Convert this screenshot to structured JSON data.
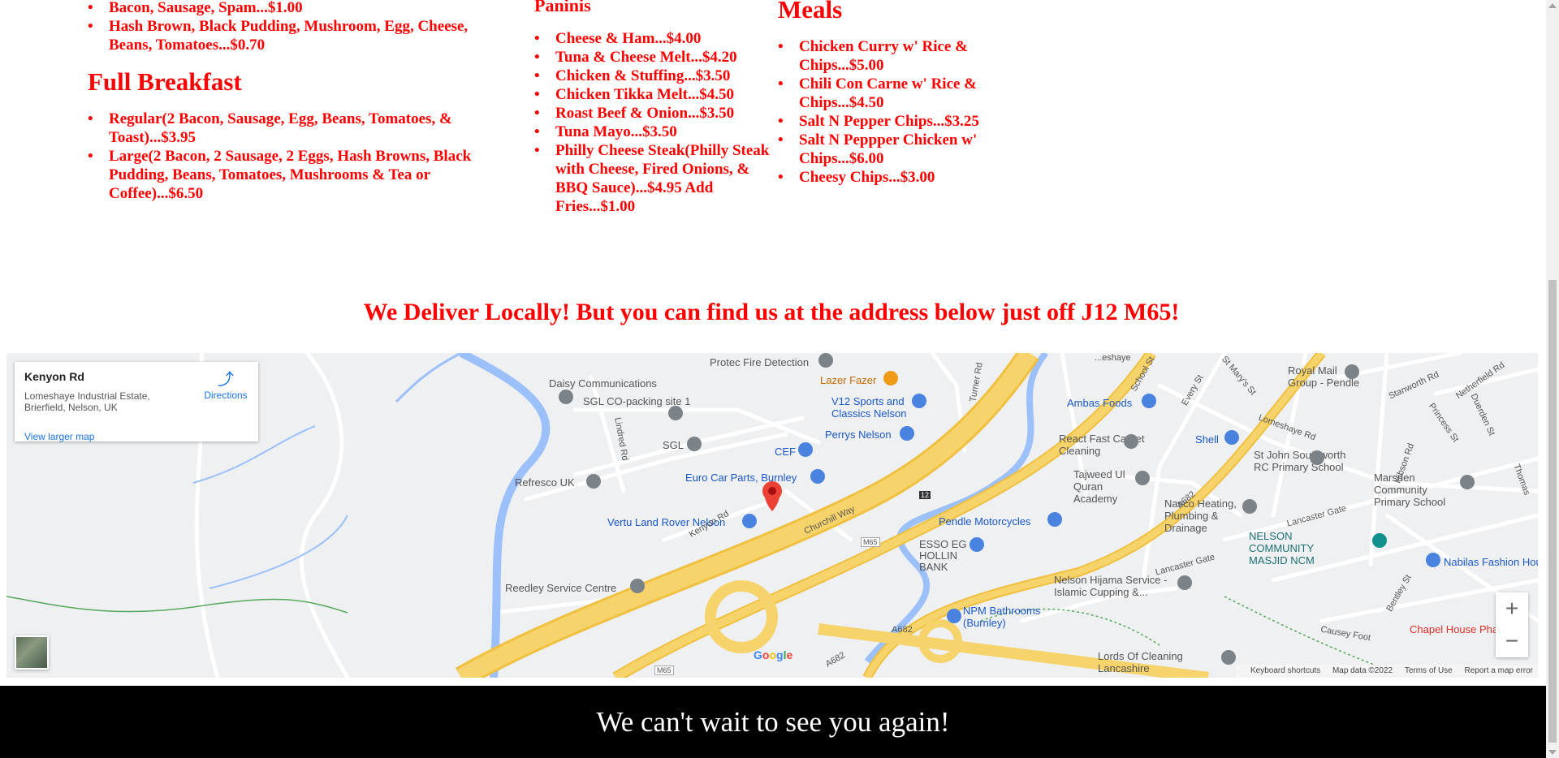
{
  "menu": {
    "col1": {
      "items_top": [
        "Bacon, Sausage, Spam...$1.00",
        "Hash Brown, Black Pudding, Mushroom, Egg, Cheese, Beans, Tomatoes...$0.70"
      ],
      "full_breakfast_heading": "Full Breakfast",
      "full_breakfast_items": [
        "Regular(2 Bacon, Sausage, Egg, Beans, Tomatoes, & Toast)...$3.95",
        "Large(2 Bacon, 2 Sausage, 2 Eggs, Hash Browns, Black Pudding, Beans, Tomatoes, Mushrooms & Tea or Coffee)...$6.50"
      ]
    },
    "col2": {
      "heading": "Paninis",
      "items": [
        "Cheese & Ham...$4.00",
        "Tuna & Cheese Melt...$4.20",
        "Chicken & Stuffing...$3.50",
        "Chicken Tikka Melt...$4.50",
        "Roast Beef & Onion...$3.50",
        "Tuna Mayo...$3.50",
        "Philly Cheese Steak(Philly Steak with Cheese, Fired Onions, & BBQ Sauce)...$4.95 Add Fries...$1.00"
      ]
    },
    "col3": {
      "heading": "Meals",
      "items": [
        "Chicken Curry w' Rice & Chips...$5.00",
        "Chili Con Carne w' Rice & Chips...$4.50",
        "Salt N Pepper Chips...$3.25",
        "Salt N Peppper Chicken w' Chips...$6.00",
        "Cheesy Chips...$3.00"
      ]
    }
  },
  "deliver_text": "We Deliver Locally! But you can find us at the address below just off J12 M65!",
  "map": {
    "card": {
      "title": "Kenyon Rd",
      "address": "Lomeshaye Industrial Estate, Brierfield, Nelson, UK",
      "larger_link": "View larger map",
      "directions": "Directions"
    },
    "places": {
      "protec": "Protec Fire Detection",
      "daisy": "Daisy Communications",
      "sgl_co": "SGL CO-packing site 1",
      "lazer": "Lazer Fazer",
      "v12": "V12 Sports and Classics Nelson",
      "perrys": "Perrys Nelson",
      "cef": "CEF",
      "sgl": "SGL",
      "euro": "Euro Car Parts, Burnley",
      "refresco": "Refresco UK",
      "vertu": "Vertu Land Rover Nelson",
      "reedley": "Reedley Service Centre",
      "ambas": "Ambas Foods",
      "royal_mail": "Royal Mail Group - Pendle",
      "shell": "Shell",
      "react": "React Fast Carpet Cleaning",
      "tajweed": "Tajweed Ul Quran Academy",
      "st_john": "St John Southworth RC Primary School",
      "marsden": "Marsden Community Primary School",
      "nasco": "Nasco Heating, Plumbing & Drainage",
      "pendle_moto": "Pendle Motorcycles",
      "esso": "ESSO EG HOLLIN BANK",
      "nelson_community": "NELSON COMMUNITY MASJID NCM",
      "nabilas": "Nabilas Fashion Hou",
      "nelson_hijama": "Nelson Hijama Service - Islamic Cupping &...",
      "npm": "NPM Bathrooms (Burnley)",
      "lords": "Lords Of Cleaning Lancashire",
      "chapel": "Chapel House Pha"
    },
    "roads": {
      "lindred": "Lindred Rd",
      "turner": "Turner Rd",
      "kenyon": "Kenyon Rd",
      "churchill": "Churchill Way",
      "m65a": "M65",
      "m65b": "M65",
      "j12": "12",
      "a682a": "A682",
      "a682b": "A682",
      "a682c": "A682",
      "lomeshaye": "Lomeshaye Rd",
      "stanworth": "Stanworth Rd",
      "netherfield": "Netherfield Rd",
      "school": "School St",
      "every": "Every St",
      "stmarys": "St Mary's St",
      "princess": "Princess St",
      "duerden": "Duerden St",
      "hibson": "Hibson Rd",
      "lancaster1": "Lancaster Gate",
      "lancaster2": "Lancaster Gate",
      "causey": "Causey Foot",
      "bentley": "Bentley St",
      "thomas": "Thomas",
      "cheshire": "...eshaye"
    },
    "google": "Google",
    "zoom_in": "+",
    "zoom_out": "−",
    "attribution": {
      "keyboard": "Keyboard shortcuts",
      "data": "Map data ©2022",
      "terms": "Terms of Use",
      "report": "Report a map error"
    },
    "colors": {
      "motorway": "#f7d36b",
      "water": "#9cc0f9",
      "marker": "#ea4335"
    }
  },
  "footer_text": "We can't wait to see you again!",
  "colors": {
    "menu_text": "#ff0000",
    "footer_bg": "#000000",
    "footer_text": "#ffffff"
  }
}
